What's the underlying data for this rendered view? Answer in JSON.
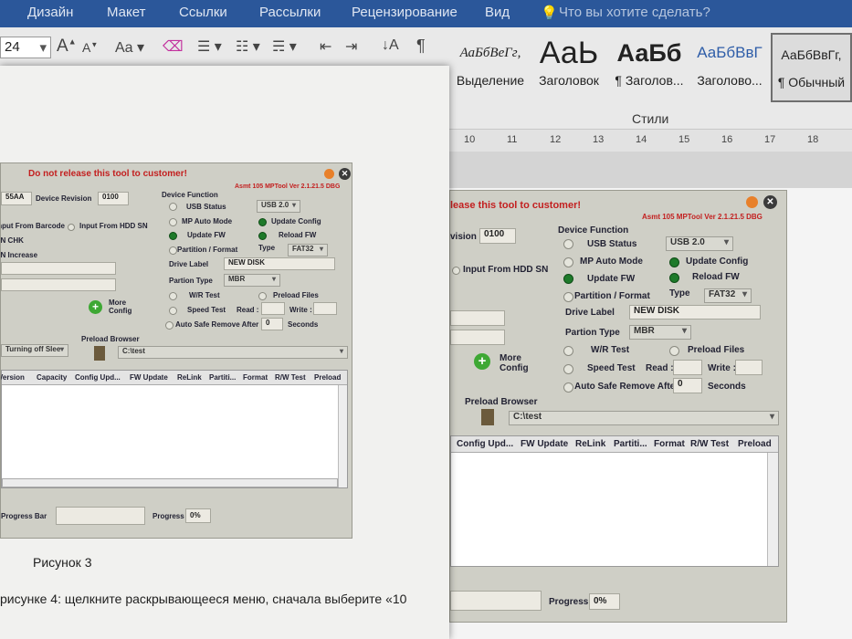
{
  "word": {
    "menu": [
      "Дизайн",
      "Макет",
      "Ссылки",
      "Рассылки",
      "Рецензирование",
      "Вид"
    ],
    "tell_me": "Что вы хотите сделать?",
    "font_size": "24",
    "styles": [
      {
        "preview": "АаБбВеГг,",
        "name": "Выделение"
      },
      {
        "preview": "АаЬ",
        "name": "Заголовок"
      },
      {
        "preview": "АаБб",
        "name": "¶ Заголов..."
      },
      {
        "preview": "АаБбВвГ",
        "name": "Заголово..."
      },
      {
        "preview": "АаБбВвГг,",
        "name": "¶ Обычный"
      }
    ],
    "styles_group": "Стили",
    "ruler": [
      "10",
      "11",
      "12",
      "13",
      "14",
      "15",
      "16",
      "17",
      "18"
    ]
  },
  "tool": {
    "warning": "Do not release this tool to customer!",
    "version": "Asmt 105 MPTool Ver 2.1.21.5 DBG",
    "vid_value": "55AA",
    "device_revision_label": "Device Revision",
    "device_revision_value": "0100",
    "input_from_barcode": "Input From Barcode",
    "input_from_hdd_sn": "Input From HDD SN",
    "sn_chk": "S/N CHK",
    "sn_increase": "S/N Increase",
    "device_function": "Device Function",
    "usb_status": "USB Status",
    "usb_status_value": "USB 2.0",
    "mp_auto_mode": "MP Auto Mode",
    "update_config": "Update Config",
    "update_fw": "Update FW",
    "reload_fw": "Reload FW",
    "partition_format": "Partition / Format",
    "type_label": "Type",
    "type_value": "FAT32",
    "drive_label": "Drive Label",
    "drive_label_value": "NEW DISK",
    "partition_type": "Partion Type",
    "partition_type_value": "MBR",
    "wr_test": "W/R Test",
    "preload_files": "Preload Files",
    "speed_test": "Speed Test",
    "read_label": "Read :",
    "write_label": "Write :",
    "auto_safe_remove": "Auto Safe Remove After",
    "auto_safe_value": "0",
    "seconds": "Seconds",
    "more_config": "More Config",
    "turning_off_sleep": "Turning off Slee",
    "preload_browser": "Preload Browser",
    "preload_path": "C:\\test",
    "columns": [
      "Version",
      "Capacity",
      "Config Upd...",
      "FW Update",
      "ReLink",
      "Partiti...",
      "Format",
      "R/W Test",
      "Preload"
    ],
    "progress_bar_label": "Progress Bar",
    "progress_label": "Progress",
    "progress_value": "0%"
  },
  "paper": {
    "figure_caption": "Рисунок 3",
    "body_text": "рисунке 4: щелкните раскрывающееся меню, сначала выберите «10"
  }
}
